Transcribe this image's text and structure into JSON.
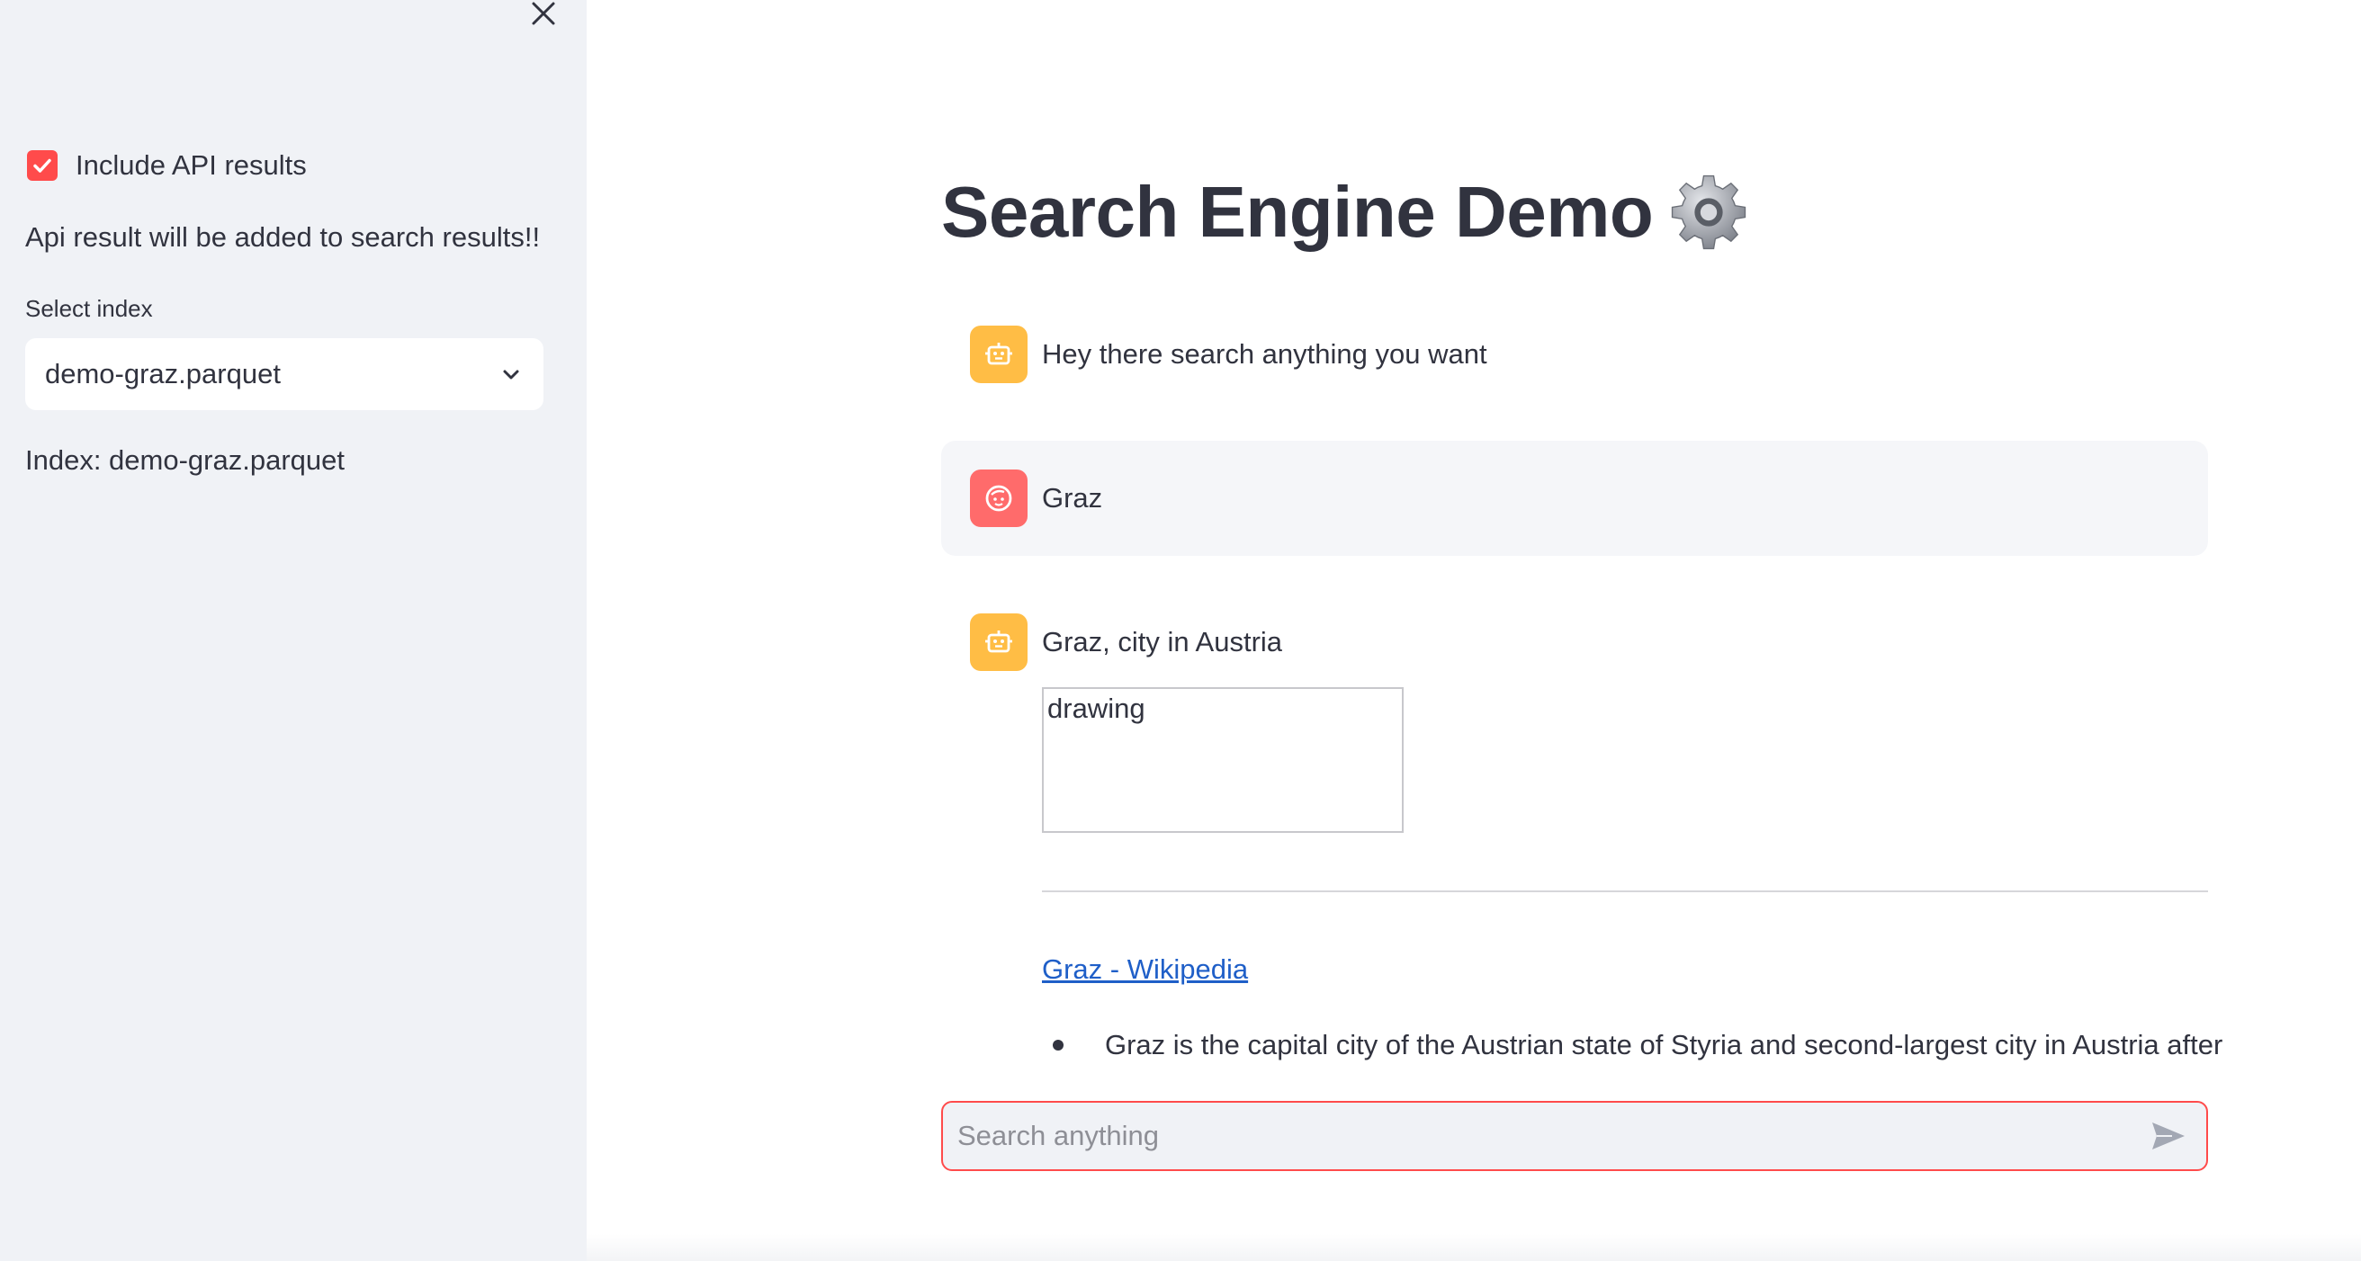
{
  "sidebar": {
    "close_icon": "close-icon",
    "checkbox": {
      "label": "Include API results",
      "checked": true
    },
    "api_note": "Api result will be added to search results!!",
    "select": {
      "label": "Select index",
      "value": "demo-graz.parquet"
    },
    "index_info": "Index: demo-graz.parquet"
  },
  "main": {
    "title": "Search Engine Demo",
    "title_icon": "gear-icon",
    "messages": [
      {
        "role": "assistant",
        "text": "Hey there search anything you want",
        "icon": "robot-icon"
      },
      {
        "role": "user",
        "text": "Graz",
        "icon": "face-icon"
      },
      {
        "role": "assistant",
        "text": "Graz, city in Austria",
        "icon": "robot-icon"
      }
    ],
    "result": {
      "image_alt": "drawing",
      "link_text": "Graz - Wikipedia",
      "bullet": "Graz is the capital city of the Austrian state of Styria and second-largest city in Austria after"
    },
    "chat_input": {
      "placeholder": "Search anything",
      "value": ""
    }
  },
  "colors": {
    "accent": "#ff4b4b",
    "bot_avatar": "#ffbd45",
    "user_avatar": "#ff6b6b",
    "sidebar_bg": "#f0f2f6",
    "link": "#1f5fc8"
  }
}
